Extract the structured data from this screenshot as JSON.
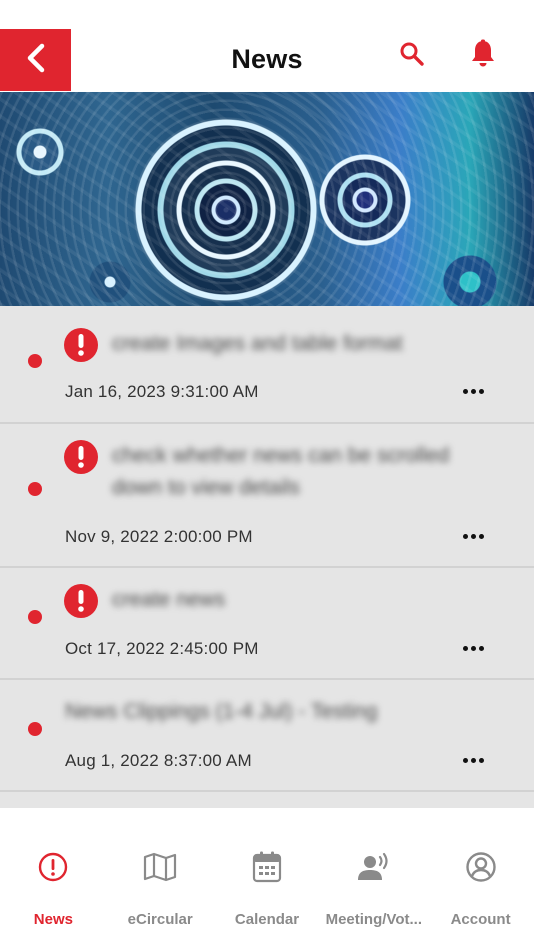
{
  "header": {
    "title": "News",
    "back_icon": "chevron-left-icon",
    "search_icon": "search-icon",
    "bell_icon": "bell-icon"
  },
  "colors": {
    "accent": "#e0252f",
    "list_background": "#e5e5e5",
    "inactive_tab": "#8a8a8a"
  },
  "news": [
    {
      "title": "create Images and table format",
      "title_line2": "",
      "date": "Jan 16, 2023 9:31:00 AM",
      "important": true,
      "unread": true
    },
    {
      "title": "check whether news can be scrolled",
      "title_line2": "down to view details",
      "date": "Nov 9, 2022 2:00:00 PM",
      "important": true,
      "unread": true
    },
    {
      "title": "create news",
      "title_line2": "",
      "date": "Oct 17, 2022 2:45:00 PM",
      "important": true,
      "unread": true
    },
    {
      "title": "News Clippings (1-4 Jul) - Testing",
      "title_line2": "",
      "date": "Aug 1, 2022 8:37:00 AM",
      "important": false,
      "unread": true
    }
  ],
  "nav": {
    "tabs": [
      {
        "label": "News",
        "icon": "alert-circle-icon",
        "active": true
      },
      {
        "label": "eCircular",
        "icon": "map-icon",
        "active": false
      },
      {
        "label": "Calendar",
        "icon": "calendar-icon",
        "active": false
      },
      {
        "label": "Meeting/Vot...",
        "icon": "speaker-person-icon",
        "active": false
      },
      {
        "label": "Account",
        "icon": "user-circle-icon",
        "active": false
      }
    ]
  }
}
